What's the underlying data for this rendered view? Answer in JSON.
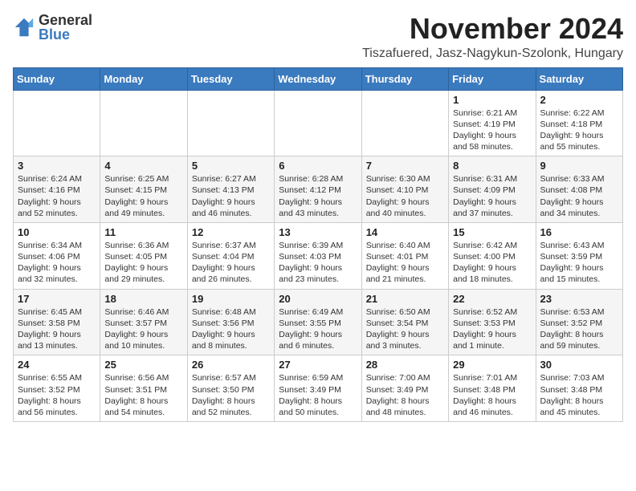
{
  "logo": {
    "line1": "General",
    "line2": "Blue"
  },
  "title": "November 2024",
  "location": "Tiszafuered, Jasz-Nagykun-Szolonk, Hungary",
  "headers": [
    "Sunday",
    "Monday",
    "Tuesday",
    "Wednesday",
    "Thursday",
    "Friday",
    "Saturday"
  ],
  "weeks": [
    [
      {
        "day": "",
        "info": ""
      },
      {
        "day": "",
        "info": ""
      },
      {
        "day": "",
        "info": ""
      },
      {
        "day": "",
        "info": ""
      },
      {
        "day": "",
        "info": ""
      },
      {
        "day": "1",
        "info": "Sunrise: 6:21 AM\nSunset: 4:19 PM\nDaylight: 9 hours\nand 58 minutes."
      },
      {
        "day": "2",
        "info": "Sunrise: 6:22 AM\nSunset: 4:18 PM\nDaylight: 9 hours\nand 55 minutes."
      }
    ],
    [
      {
        "day": "3",
        "info": "Sunrise: 6:24 AM\nSunset: 4:16 PM\nDaylight: 9 hours\nand 52 minutes."
      },
      {
        "day": "4",
        "info": "Sunrise: 6:25 AM\nSunset: 4:15 PM\nDaylight: 9 hours\nand 49 minutes."
      },
      {
        "day": "5",
        "info": "Sunrise: 6:27 AM\nSunset: 4:13 PM\nDaylight: 9 hours\nand 46 minutes."
      },
      {
        "day": "6",
        "info": "Sunrise: 6:28 AM\nSunset: 4:12 PM\nDaylight: 9 hours\nand 43 minutes."
      },
      {
        "day": "7",
        "info": "Sunrise: 6:30 AM\nSunset: 4:10 PM\nDaylight: 9 hours\nand 40 minutes."
      },
      {
        "day": "8",
        "info": "Sunrise: 6:31 AM\nSunset: 4:09 PM\nDaylight: 9 hours\nand 37 minutes."
      },
      {
        "day": "9",
        "info": "Sunrise: 6:33 AM\nSunset: 4:08 PM\nDaylight: 9 hours\nand 34 minutes."
      }
    ],
    [
      {
        "day": "10",
        "info": "Sunrise: 6:34 AM\nSunset: 4:06 PM\nDaylight: 9 hours\nand 32 minutes."
      },
      {
        "day": "11",
        "info": "Sunrise: 6:36 AM\nSunset: 4:05 PM\nDaylight: 9 hours\nand 29 minutes."
      },
      {
        "day": "12",
        "info": "Sunrise: 6:37 AM\nSunset: 4:04 PM\nDaylight: 9 hours\nand 26 minutes."
      },
      {
        "day": "13",
        "info": "Sunrise: 6:39 AM\nSunset: 4:03 PM\nDaylight: 9 hours\nand 23 minutes."
      },
      {
        "day": "14",
        "info": "Sunrise: 6:40 AM\nSunset: 4:01 PM\nDaylight: 9 hours\nand 21 minutes."
      },
      {
        "day": "15",
        "info": "Sunrise: 6:42 AM\nSunset: 4:00 PM\nDaylight: 9 hours\nand 18 minutes."
      },
      {
        "day": "16",
        "info": "Sunrise: 6:43 AM\nSunset: 3:59 PM\nDaylight: 9 hours\nand 15 minutes."
      }
    ],
    [
      {
        "day": "17",
        "info": "Sunrise: 6:45 AM\nSunset: 3:58 PM\nDaylight: 9 hours\nand 13 minutes."
      },
      {
        "day": "18",
        "info": "Sunrise: 6:46 AM\nSunset: 3:57 PM\nDaylight: 9 hours\nand 10 minutes."
      },
      {
        "day": "19",
        "info": "Sunrise: 6:48 AM\nSunset: 3:56 PM\nDaylight: 9 hours\nand 8 minutes."
      },
      {
        "day": "20",
        "info": "Sunrise: 6:49 AM\nSunset: 3:55 PM\nDaylight: 9 hours\nand 6 minutes."
      },
      {
        "day": "21",
        "info": "Sunrise: 6:50 AM\nSunset: 3:54 PM\nDaylight: 9 hours\nand 3 minutes."
      },
      {
        "day": "22",
        "info": "Sunrise: 6:52 AM\nSunset: 3:53 PM\nDaylight: 9 hours\nand 1 minute."
      },
      {
        "day": "23",
        "info": "Sunrise: 6:53 AM\nSunset: 3:52 PM\nDaylight: 8 hours\nand 59 minutes."
      }
    ],
    [
      {
        "day": "24",
        "info": "Sunrise: 6:55 AM\nSunset: 3:52 PM\nDaylight: 8 hours\nand 56 minutes."
      },
      {
        "day": "25",
        "info": "Sunrise: 6:56 AM\nSunset: 3:51 PM\nDaylight: 8 hours\nand 54 minutes."
      },
      {
        "day": "26",
        "info": "Sunrise: 6:57 AM\nSunset: 3:50 PM\nDaylight: 8 hours\nand 52 minutes."
      },
      {
        "day": "27",
        "info": "Sunrise: 6:59 AM\nSunset: 3:49 PM\nDaylight: 8 hours\nand 50 minutes."
      },
      {
        "day": "28",
        "info": "Sunrise: 7:00 AM\nSunset: 3:49 PM\nDaylight: 8 hours\nand 48 minutes."
      },
      {
        "day": "29",
        "info": "Sunrise: 7:01 AM\nSunset: 3:48 PM\nDaylight: 8 hours\nand 46 minutes."
      },
      {
        "day": "30",
        "info": "Sunrise: 7:03 AM\nSunset: 3:48 PM\nDaylight: 8 hours\nand 45 minutes."
      }
    ]
  ]
}
